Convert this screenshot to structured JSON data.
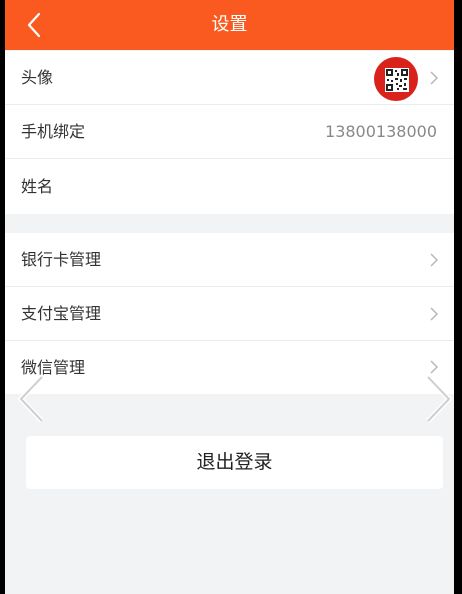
{
  "header": {
    "title": "设置",
    "background": "#fa5a1f",
    "back_icon": "chevron-left-icon"
  },
  "profile": {
    "avatar_label": "头像",
    "phone_label": "手机绑定",
    "phone_value": "13800138000",
    "name_label": "姓名"
  },
  "accounts": {
    "bank_card_label": "银行卡管理",
    "alipay_label": "支付宝管理",
    "wechat_label": "微信管理"
  },
  "logout": {
    "label": "退出登录"
  }
}
